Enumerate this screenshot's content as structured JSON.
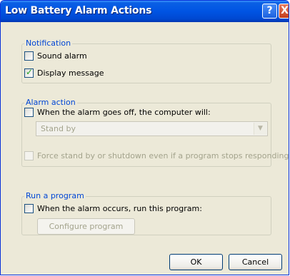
{
  "window": {
    "title": "Low Battery Alarm Actions",
    "help_glyph": "?",
    "close_glyph": "X"
  },
  "notification": {
    "label": "Notification",
    "sound_alarm": {
      "label": "Sound alarm",
      "checked": false
    },
    "display_message": {
      "label": "Display message",
      "checked": true
    }
  },
  "alarm_action": {
    "label": "Alarm action",
    "when_alarm_checkbox": {
      "label": "When the alarm goes off, the computer will:",
      "checked": false
    },
    "action_select": {
      "value": "Stand by",
      "enabled": false
    },
    "force_checkbox": {
      "label": "Force stand by or shutdown even if a program stops responding.",
      "checked": false,
      "enabled": false
    }
  },
  "run_program": {
    "label": "Run a program",
    "when_alarm_checkbox": {
      "label": "When the alarm occurs, run this program:",
      "checked": false
    },
    "configure_button": "Configure program"
  },
  "buttons": {
    "ok": "OK",
    "cancel": "Cancel"
  },
  "icons": {
    "check": "✓",
    "dropdown": "▼"
  }
}
